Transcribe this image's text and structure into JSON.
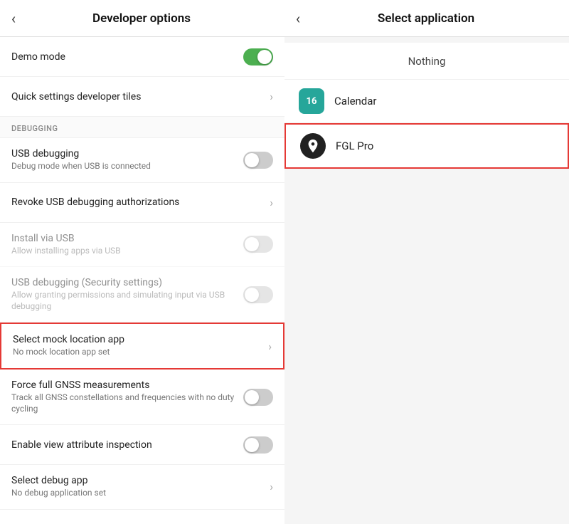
{
  "left": {
    "back_label": "‹",
    "title": "Developer options",
    "items": [
      {
        "id": "demo-mode",
        "type": "toggle",
        "title": "Demo mode",
        "subtitle": null,
        "toggle_on": true,
        "disabled": false,
        "highlighted": false
      },
      {
        "id": "quick-settings",
        "type": "chevron",
        "title": "Quick settings developer tiles",
        "subtitle": null,
        "disabled": false,
        "highlighted": false
      },
      {
        "id": "debugging-section",
        "type": "section",
        "label": "DEBUGGING"
      },
      {
        "id": "usb-debugging",
        "type": "toggle",
        "title": "USB debugging",
        "subtitle": "Debug mode when USB is connected",
        "toggle_on": false,
        "disabled": false,
        "highlighted": false
      },
      {
        "id": "revoke-usb",
        "type": "chevron",
        "title": "Revoke USB debugging authorizations",
        "subtitle": null,
        "disabled": false,
        "highlighted": false
      },
      {
        "id": "install-usb",
        "type": "toggle",
        "title": "Install via USB",
        "subtitle": "Allow installing apps via USB",
        "toggle_on": false,
        "disabled": true,
        "highlighted": false
      },
      {
        "id": "usb-security",
        "type": "toggle",
        "title": "USB debugging (Security settings)",
        "subtitle": "Allow granting permissions and simulating input via USB debugging",
        "toggle_on": false,
        "disabled": true,
        "highlighted": false
      },
      {
        "id": "mock-location",
        "type": "chevron",
        "title": "Select mock location app",
        "subtitle": "No mock location app set",
        "disabled": false,
        "highlighted": true
      },
      {
        "id": "gnss",
        "type": "toggle",
        "title": "Force full GNSS measurements",
        "subtitle": "Track all GNSS constellations and frequencies with no duty cycling",
        "toggle_on": false,
        "disabled": false,
        "highlighted": false
      },
      {
        "id": "view-attr",
        "type": "toggle",
        "title": "Enable view attribute inspection",
        "subtitle": null,
        "toggle_on": false,
        "disabled": false,
        "highlighted": false
      },
      {
        "id": "debug-app",
        "type": "chevron",
        "title": "Select debug app",
        "subtitle": "No debug application set",
        "disabled": false,
        "highlighted": false
      }
    ]
  },
  "right": {
    "back_label": "‹",
    "title": "Select application",
    "apps": [
      {
        "id": "nothing",
        "type": "nothing",
        "name": "Nothing"
      },
      {
        "id": "calendar",
        "type": "app",
        "name": "Calendar",
        "icon_label": "16",
        "icon_bg": "#26a69a",
        "icon_shape": "square",
        "highlighted": false
      },
      {
        "id": "fgl-pro",
        "type": "app",
        "name": "FGL Pro",
        "icon_label": "📍",
        "icon_bg": "#212121",
        "icon_shape": "circle",
        "highlighted": true
      }
    ]
  }
}
